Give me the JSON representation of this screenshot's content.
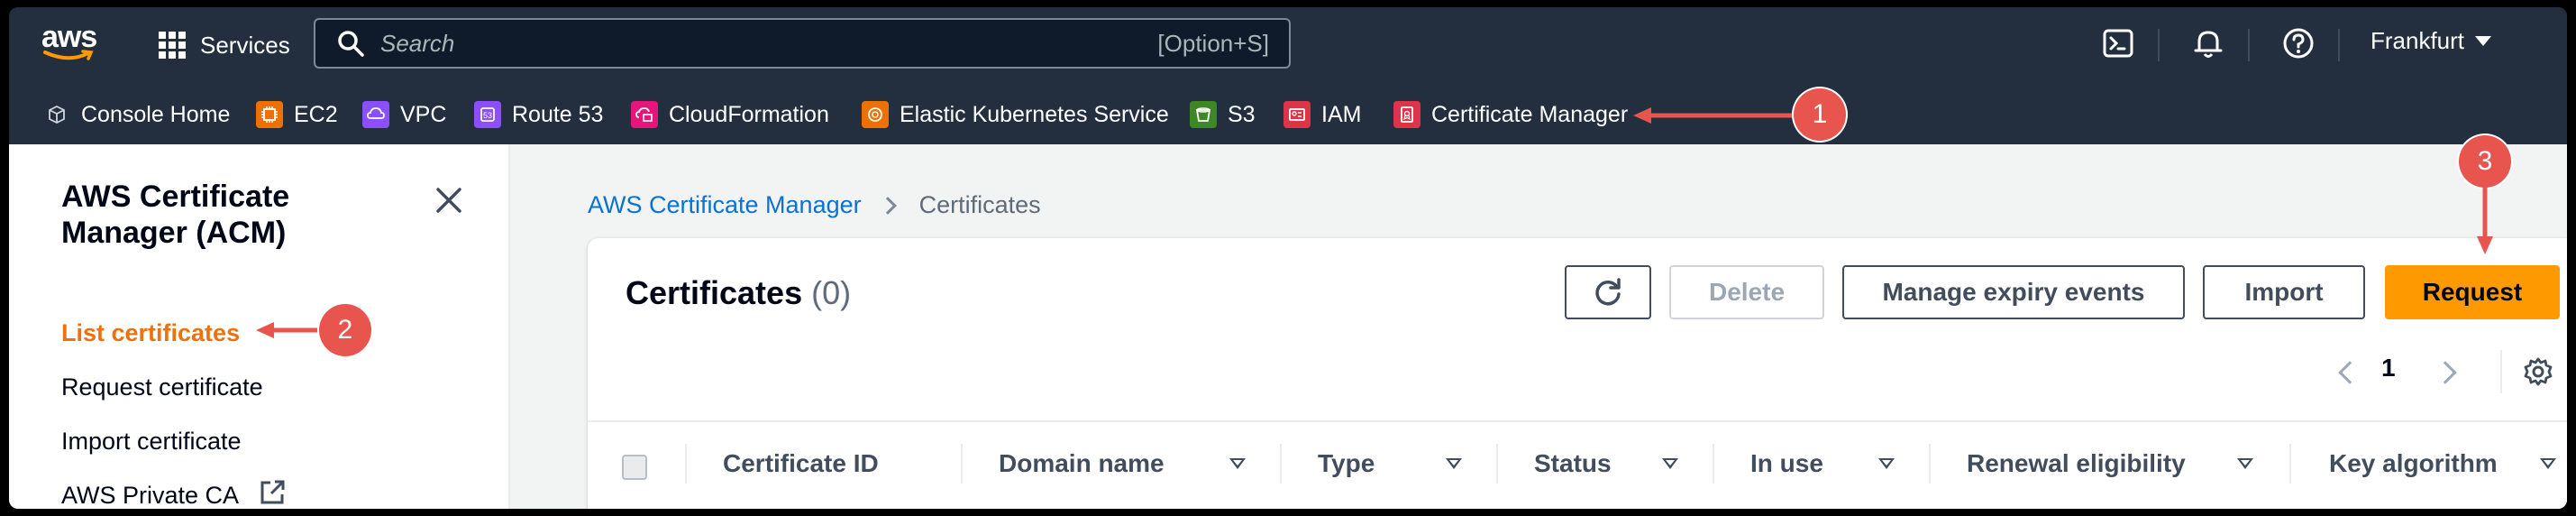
{
  "topnav": {
    "logo": "aws",
    "services_label": "Services",
    "search_placeholder": "Search",
    "search_shortcut": "[Option+S]",
    "region_label": "Frankfurt",
    "icons": [
      "cloudshell-icon",
      "notifications-icon",
      "help-icon"
    ]
  },
  "favorites": [
    {
      "label": "Console Home",
      "icon": "cube-icon",
      "color": "#232f3e"
    },
    {
      "label": "EC2",
      "icon": "ec2-icon",
      "color": "#ed7100"
    },
    {
      "label": "VPC",
      "icon": "vpc-icon",
      "color": "#8c4fff"
    },
    {
      "label": "Route 53",
      "icon": "route53-icon",
      "color": "#8c4fff"
    },
    {
      "label": "CloudFormation",
      "icon": "cloudformation-icon",
      "color": "#e7157b"
    },
    {
      "label": "Elastic Kubernetes Service",
      "icon": "eks-icon",
      "color": "#ed7100"
    },
    {
      "label": "S3",
      "icon": "s3-icon",
      "color": "#3f8624"
    },
    {
      "label": "IAM",
      "icon": "iam-icon",
      "color": "#dd344c"
    },
    {
      "label": "Certificate Manager",
      "icon": "acm-icon",
      "color": "#dd344c"
    }
  ],
  "annotations": [
    "1",
    "2",
    "3"
  ],
  "sidebar": {
    "title": "AWS Certificate Manager (ACM)",
    "items": [
      {
        "label": "List certificates",
        "active": true
      },
      {
        "label": "Request certificate"
      },
      {
        "label": "Import certificate"
      },
      {
        "label": "AWS Private CA"
      }
    ]
  },
  "breadcrumb": {
    "parent": "AWS Certificate Manager",
    "current": "Certificates"
  },
  "panel": {
    "title": "Certificates",
    "count": "(0)",
    "buttons": {
      "delete": "Delete",
      "manage_expiry": "Manage expiry events",
      "import": "Import",
      "request": "Request"
    },
    "page": "1"
  },
  "table": {
    "columns": [
      "Certificate ID",
      "Domain name",
      "Type",
      "Status",
      "In use",
      "Renewal eligibility",
      "Key algorithm"
    ]
  },
  "colors": {
    "nav_bg": "#232f3e",
    "accent_orange": "#ff9900",
    "active_link": "#ec7211",
    "link_blue": "#0972d3",
    "annotation_red": "#e8554e"
  }
}
